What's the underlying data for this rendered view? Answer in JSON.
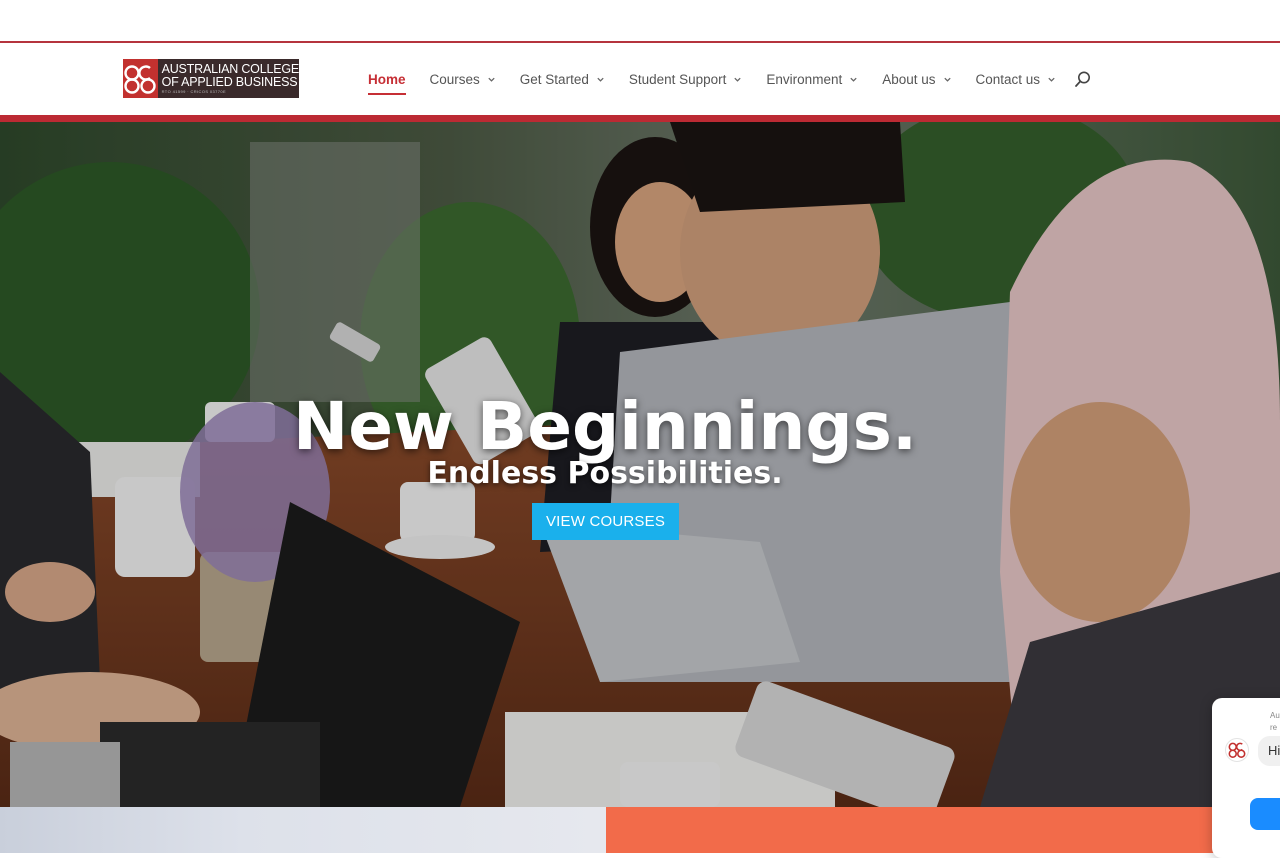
{
  "logo": {
    "line1": "AUSTRALIAN COLLEGE",
    "line2": "OF APPLIED BUSINESS",
    "tagline": "RTO 41599 · CRICOS 03770E",
    "icon": "acab-logo-icon",
    "brand_color": "#c2312f"
  },
  "nav": {
    "items": [
      {
        "label": "Home",
        "active": true,
        "has_dropdown": false
      },
      {
        "label": "Courses",
        "active": false,
        "has_dropdown": true
      },
      {
        "label": "Get Started",
        "active": false,
        "has_dropdown": true
      },
      {
        "label": "Student Support",
        "active": false,
        "has_dropdown": true
      },
      {
        "label": "Environment",
        "active": false,
        "has_dropdown": true
      },
      {
        "label": "About us",
        "active": false,
        "has_dropdown": true
      },
      {
        "label": "Contact us",
        "active": false,
        "has_dropdown": true
      }
    ],
    "search_icon": "search-icon",
    "active_color": "#c62f35"
  },
  "hero": {
    "title": "New Beginnings.",
    "subtitle": "Endless Possibilities.",
    "cta_label": "VIEW COURSES",
    "cta_color": "#1ab0ec",
    "image": "students-studying-with-laptop-and-tablets"
  },
  "chat_widget": {
    "meta_line1": "Au",
    "meta_line2": "re",
    "greeting": "Hi",
    "avatar_icon": "acab-logo-icon",
    "send_color": "#1a8cff"
  },
  "colors": {
    "accent_red": "#bc2a33",
    "panel_orange": "#f26b4a"
  }
}
